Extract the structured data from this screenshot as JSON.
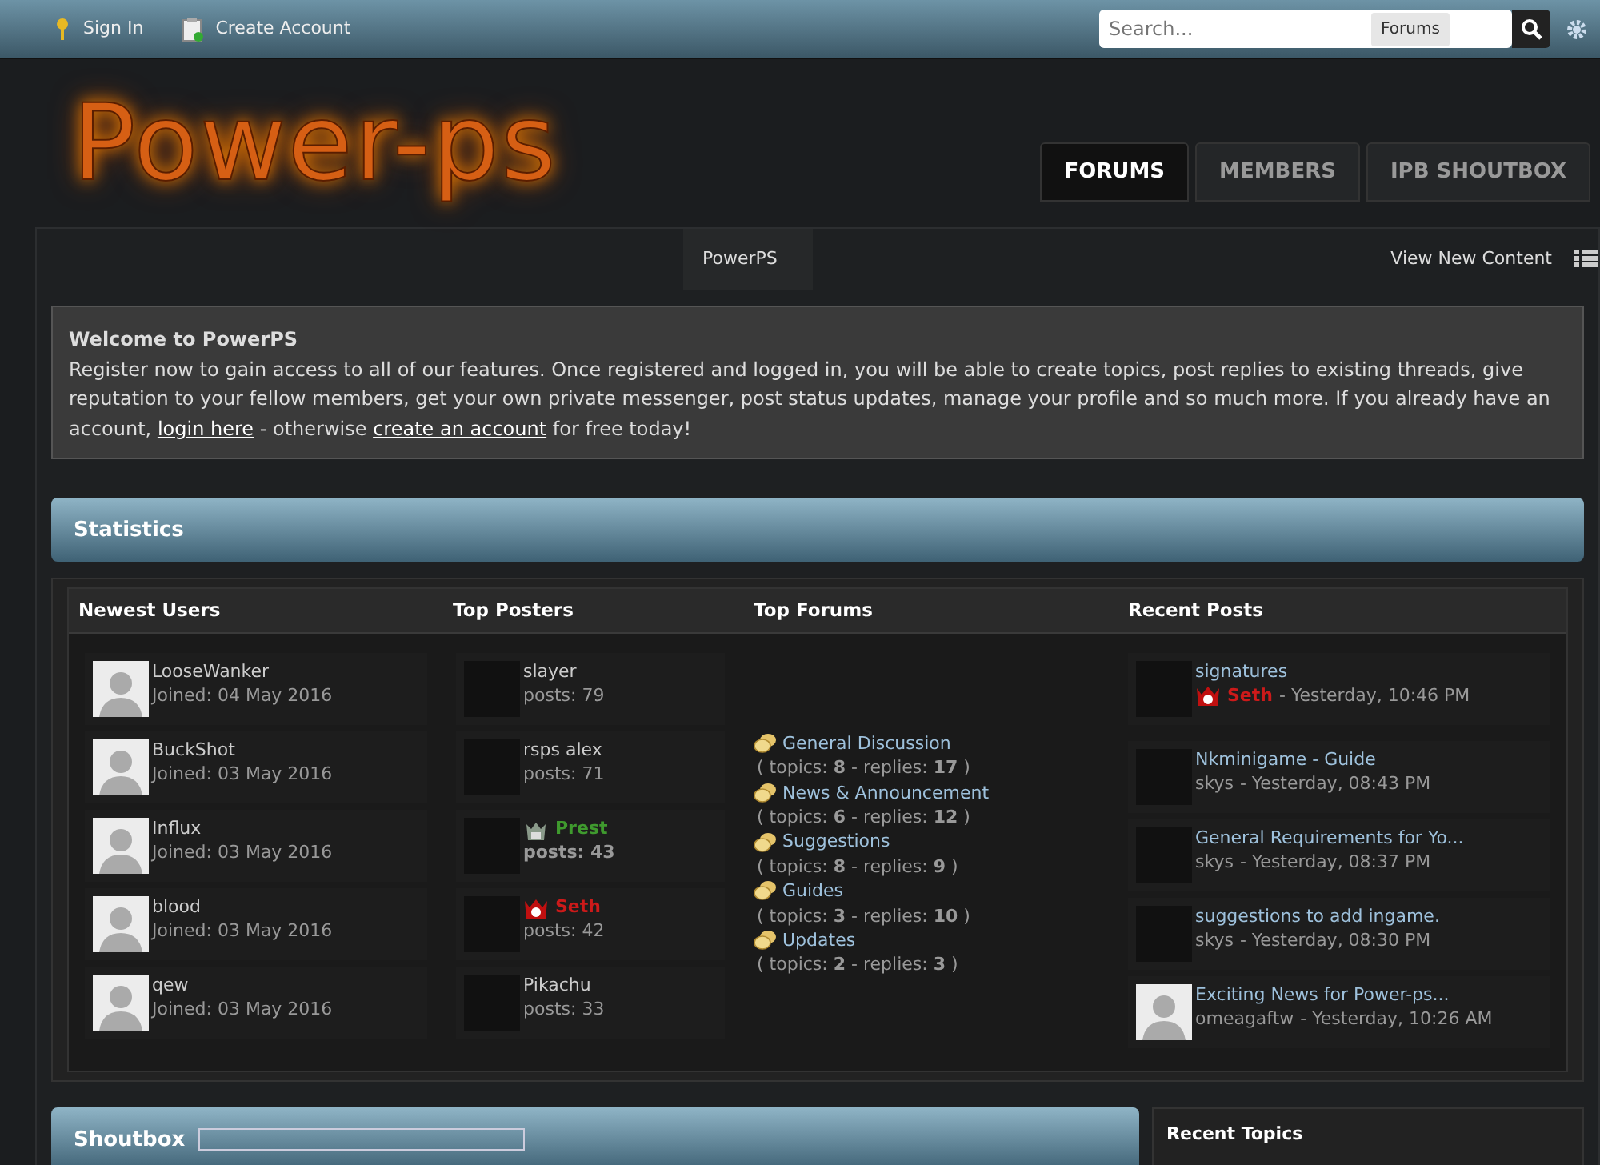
{
  "top_bar": {
    "links": [
      "Sign In",
      "Create Account"
    ],
    "search": {
      "placeholder": "Search...",
      "scope": "Forums"
    }
  },
  "logo": "Power-ps",
  "nav_tabs": [
    {
      "label": "FORUMS",
      "selected": true
    },
    {
      "label": "MEMBERS",
      "selected": false
    },
    {
      "label": "IPB SHOUTBOX",
      "selected": false
    }
  ],
  "breadcrumb": {
    "crumb": "PowerPS",
    "link": "View New Content"
  },
  "welcome": {
    "title": "Welcome to PowerPS",
    "text_before": "Register now to gain access to all of our features. Once registered and logged in, you will be able to create topics, post replies to existing threads, give reputation to your fellow members, get your own private messenger, post status updates, manage your profile and so much more. If you already have an account,",
    "login_link": "login here",
    "text_middle": "- otherwise",
    "create_link": "create an account",
    "text_after": "for free today!"
  },
  "statistics": {
    "title": "Statistics",
    "columns": [
      "Newest Users",
      "Top Posters",
      "Top Forums",
      "Recent Posts"
    ],
    "newest_users": [
      {
        "name": "LooseWanker",
        "joined": "Joined: 04 May 2016"
      },
      {
        "name": "BuckShot",
        "joined": "Joined: 03 May 2016"
      },
      {
        "name": "Influx",
        "joined": "Joined: 03 May 2016"
      },
      {
        "name": "blood",
        "joined": "Joined: 03 May 2016"
      },
      {
        "name": "qew",
        "joined": "Joined: 03 May 2016"
      }
    ],
    "top_posters": [
      {
        "name": "slayer",
        "posts": "posts: 79",
        "kind": "member",
        "color": "#cccccc"
      },
      {
        "name": "rsps alex",
        "posts": "posts: 71",
        "kind": "member",
        "color": "#cccccc"
      },
      {
        "name": "Prest",
        "posts": "posts: 43",
        "kind": "moderator",
        "color": "#3f9a2e"
      },
      {
        "name": "Seth",
        "posts": "posts: 42",
        "kind": "admin",
        "color": "#cc1a1a"
      },
      {
        "name": "Pikachu",
        "posts": "posts: 33",
        "kind": "member",
        "color": "#cccccc"
      }
    ],
    "top_forums": [
      {
        "name": "General Discussion",
        "stats": "( topics: **8** - replies: **17** )"
      },
      {
        "name": "News & Announcement",
        "stats": "( topics: **6** - replies: **12** )"
      },
      {
        "name": "Suggestions",
        "stats": "( topics: **8** - replies: **9** )"
      },
      {
        "name": "Guides",
        "stats": "( topics: **3** - replies: **10** )"
      },
      {
        "name": "Updates",
        "stats": "( topics: **2** - replies: **3** )"
      }
    ],
    "recent_posts": [
      {
        "title": "signatures",
        "author": "Seth",
        "time": "- Yesterday, 10:46 PM",
        "kind": "admin",
        "color": "#cc1a1a"
      },
      {
        "title": "Nkminigame - Guide",
        "author": "skys",
        "time": "- Yesterday, 08:43 PM",
        "kind": "member",
        "color": "#999999"
      },
      {
        "title": "General Requirements for Yo...",
        "author": "skys",
        "time": "- Yesterday, 08:37 PM",
        "kind": "member",
        "color": "#999999"
      },
      {
        "title": "suggestions to add ingame.",
        "author": "skys",
        "time": "- Yesterday, 08:30 PM",
        "kind": "member",
        "color": "#999999"
      },
      {
        "title": "Exciting News for Power-ps...",
        "author": "omeagaftw",
        "time": "- Yesterday, 10:26 AM",
        "kind": "member",
        "color": "#999999"
      }
    ]
  },
  "shoutbox": {
    "title": "Shoutbox"
  },
  "recent_topics": {
    "title": "Recent Topics"
  }
}
